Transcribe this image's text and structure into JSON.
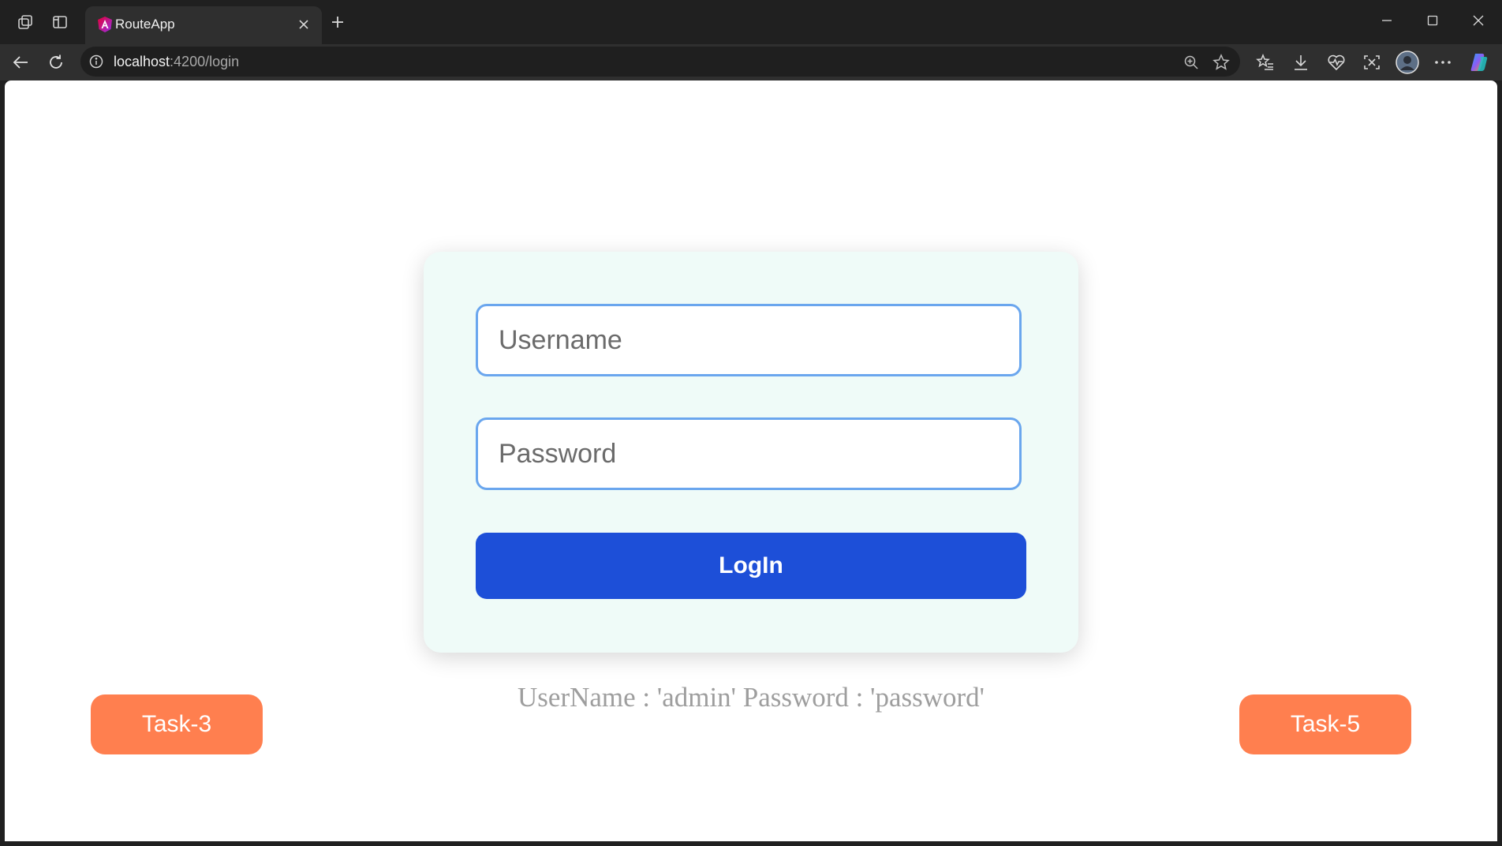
{
  "browser": {
    "tab": {
      "title": "RouteApp",
      "favicon": "angular-logo-icon"
    },
    "address": {
      "host": "localhost",
      "path": ":4200/login"
    },
    "icons": {
      "workspaces": "workspaces-icon",
      "tab_actions": "tab-actions-icon",
      "new_tab": "plus-icon",
      "back": "back-arrow-icon",
      "refresh": "refresh-icon",
      "site_info": "info-icon",
      "zoom": "zoom-icon",
      "favorite": "star-icon",
      "favorites": "favorites-icon",
      "downloads": "download-icon",
      "health": "heartbeat-icon",
      "screenshot": "screenshot-icon",
      "profile": "profile-avatar",
      "more": "more-icon",
      "copilot": "copilot-icon"
    }
  },
  "login": {
    "username_placeholder": "Username",
    "password_placeholder": "Password",
    "submit_label": "LogIn"
  },
  "hint": "UserName : 'admin' Password : 'password'",
  "nav": {
    "prev_label": "Task-3",
    "next_label": "Task-5"
  },
  "colors": {
    "card_bg": "#effbf8",
    "input_border": "#6aa6ee",
    "primary": "#1d4fd8",
    "accent": "#ff7f4f",
    "hint_text": "#9e9e9e"
  }
}
